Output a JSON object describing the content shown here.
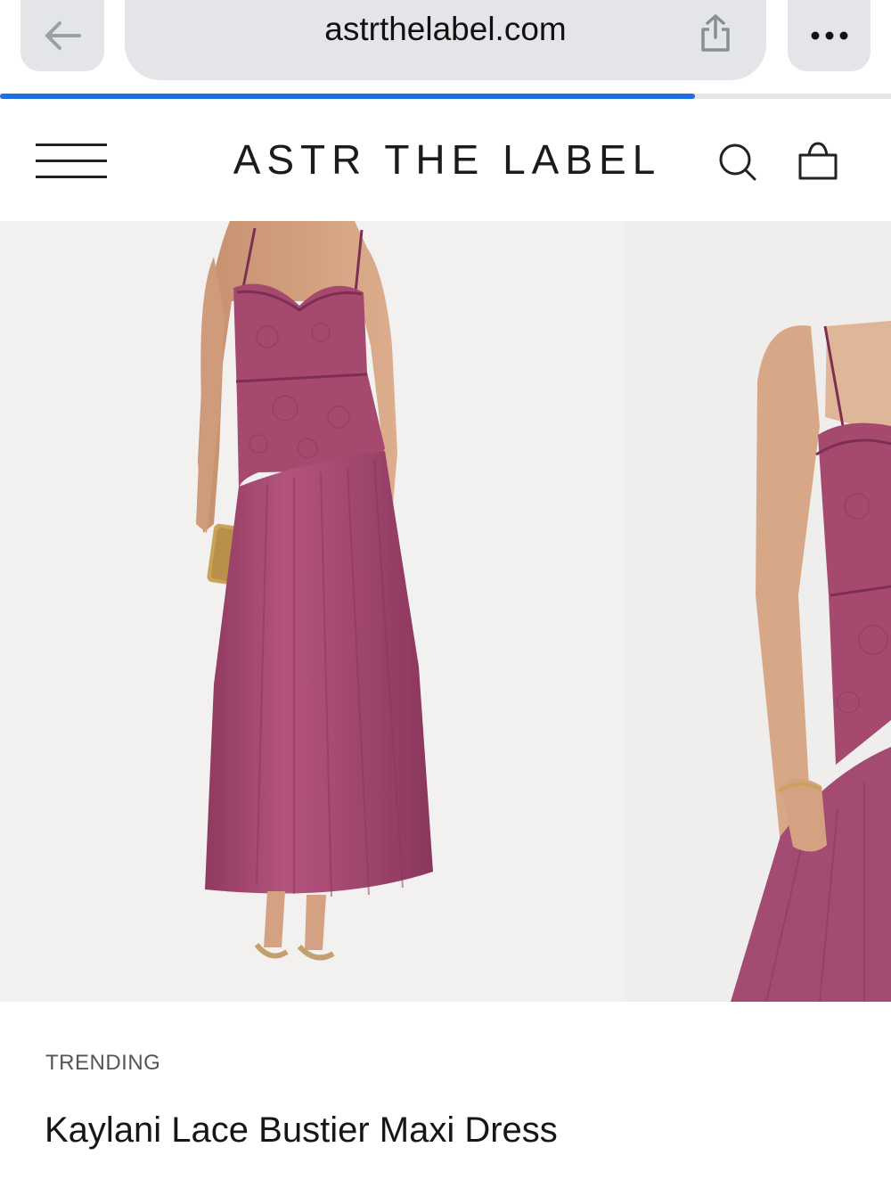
{
  "browser": {
    "url": "astrthelabel.com",
    "page_load_progress": 0.78,
    "accent_color": "#1f6fe0",
    "icons": [
      "back-arrow-icon",
      "share-icon",
      "more-icon"
    ]
  },
  "header": {
    "brand": "ASTR THE LABEL",
    "icons": [
      "hamburger-menu-icon",
      "search-icon",
      "shopping-bag-icon"
    ]
  },
  "gallery": {
    "dress_color": "#a84a72"
  },
  "product": {
    "badge": "TRENDING",
    "title": "Kaylani Lace Bustier Maxi Dress"
  }
}
